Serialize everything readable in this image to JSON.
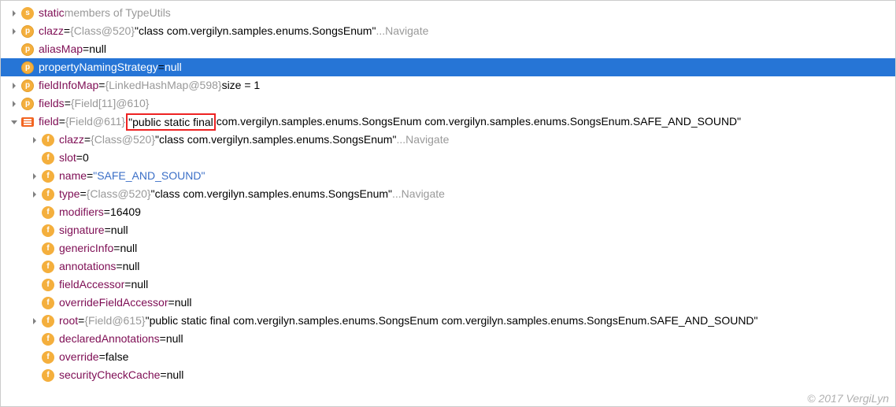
{
  "footer": "© 2017 VergiLyn",
  "navigate": "Navigate",
  "rows": [
    {
      "depth": 0,
      "arrow": "right",
      "icon": "s",
      "name": "static",
      "gray": " members of TypeUtils"
    },
    {
      "depth": 0,
      "arrow": "right",
      "icon": "p",
      "name": "clazz",
      "eq": " = ",
      "gray1": "{Class@520}",
      "str": " \"class com.vergilyn.samples.enums.SongsEnum\"",
      "ell": " ... ",
      "nav": true
    },
    {
      "depth": 0,
      "arrow": "none",
      "icon": "p",
      "name": "aliasMap",
      "eq": " = ",
      "val": "null"
    },
    {
      "depth": 0,
      "arrow": "none",
      "icon": "p",
      "name": "propertyNamingStrategy",
      "eq": " = ",
      "val": "null",
      "selected": true
    },
    {
      "depth": 0,
      "arrow": "right",
      "icon": "p",
      "name": "fieldInfoMap",
      "eq": " = ",
      "gray1": "{LinkedHashMap@598}",
      "after": "  size = 1"
    },
    {
      "depth": 0,
      "arrow": "right",
      "icon": "p",
      "name": "fields",
      "eq": " = ",
      "gray1": "{Field[11]@610}"
    },
    {
      "depth": 0,
      "arrow": "down",
      "icon": "eq",
      "name": "field",
      "eq": " = ",
      "gray1": "{Field@611}",
      "boxed": " \"public static final",
      "boxAfter": " com.vergilyn.samples.enums.SongsEnum com.vergilyn.samples.enums.SongsEnum.SAFE_AND_SOUND\""
    },
    {
      "depth": 1,
      "arrow": "right",
      "icon": "f",
      "name": "clazz",
      "eq": " = ",
      "gray1": "{Class@520}",
      "str": " \"class com.vergilyn.samples.enums.SongsEnum\"",
      "ell": " ... ",
      "nav": true
    },
    {
      "depth": 1,
      "arrow": "none",
      "icon": "f",
      "name": "slot",
      "eq": " = ",
      "val": "0"
    },
    {
      "depth": 1,
      "arrow": "right",
      "icon": "f",
      "name": "name",
      "eq": " = ",
      "linkval": "\"SAFE_AND_SOUND\""
    },
    {
      "depth": 1,
      "arrow": "right",
      "icon": "f",
      "name": "type",
      "eq": " = ",
      "gray1": "{Class@520}",
      "str": " \"class com.vergilyn.samples.enums.SongsEnum\"",
      "ell": " ... ",
      "nav": true
    },
    {
      "depth": 1,
      "arrow": "none",
      "icon": "f",
      "name": "modifiers",
      "eq": " = ",
      "val": "16409"
    },
    {
      "depth": 1,
      "arrow": "none",
      "icon": "f",
      "name": "signature",
      "eq": " = ",
      "val": "null"
    },
    {
      "depth": 1,
      "arrow": "none",
      "icon": "f",
      "name": "genericInfo",
      "eq": " = ",
      "val": "null"
    },
    {
      "depth": 1,
      "arrow": "none",
      "icon": "f",
      "name": "annotations",
      "eq": " = ",
      "val": "null"
    },
    {
      "depth": 1,
      "arrow": "none",
      "icon": "f",
      "name": "fieldAccessor",
      "eq": " = ",
      "val": "null"
    },
    {
      "depth": 1,
      "arrow": "none",
      "icon": "f",
      "name": "overrideFieldAccessor",
      "eq": " = ",
      "val": "null"
    },
    {
      "depth": 1,
      "arrow": "right",
      "icon": "f",
      "name": "root",
      "eq": " = ",
      "gray1": "{Field@615}",
      "str": " \"public static final com.vergilyn.samples.enums.SongsEnum com.vergilyn.samples.enums.SongsEnum.SAFE_AND_SOUND\""
    },
    {
      "depth": 1,
      "arrow": "none",
      "icon": "f",
      "name": "declaredAnnotations",
      "eq": " = ",
      "val": "null"
    },
    {
      "depth": 1,
      "arrow": "none",
      "icon": "f",
      "name": "override",
      "eq": " = ",
      "val": "false"
    },
    {
      "depth": 1,
      "arrow": "none",
      "icon": "f",
      "name": "securityCheckCache",
      "eq": " = ",
      "val": "null"
    }
  ]
}
